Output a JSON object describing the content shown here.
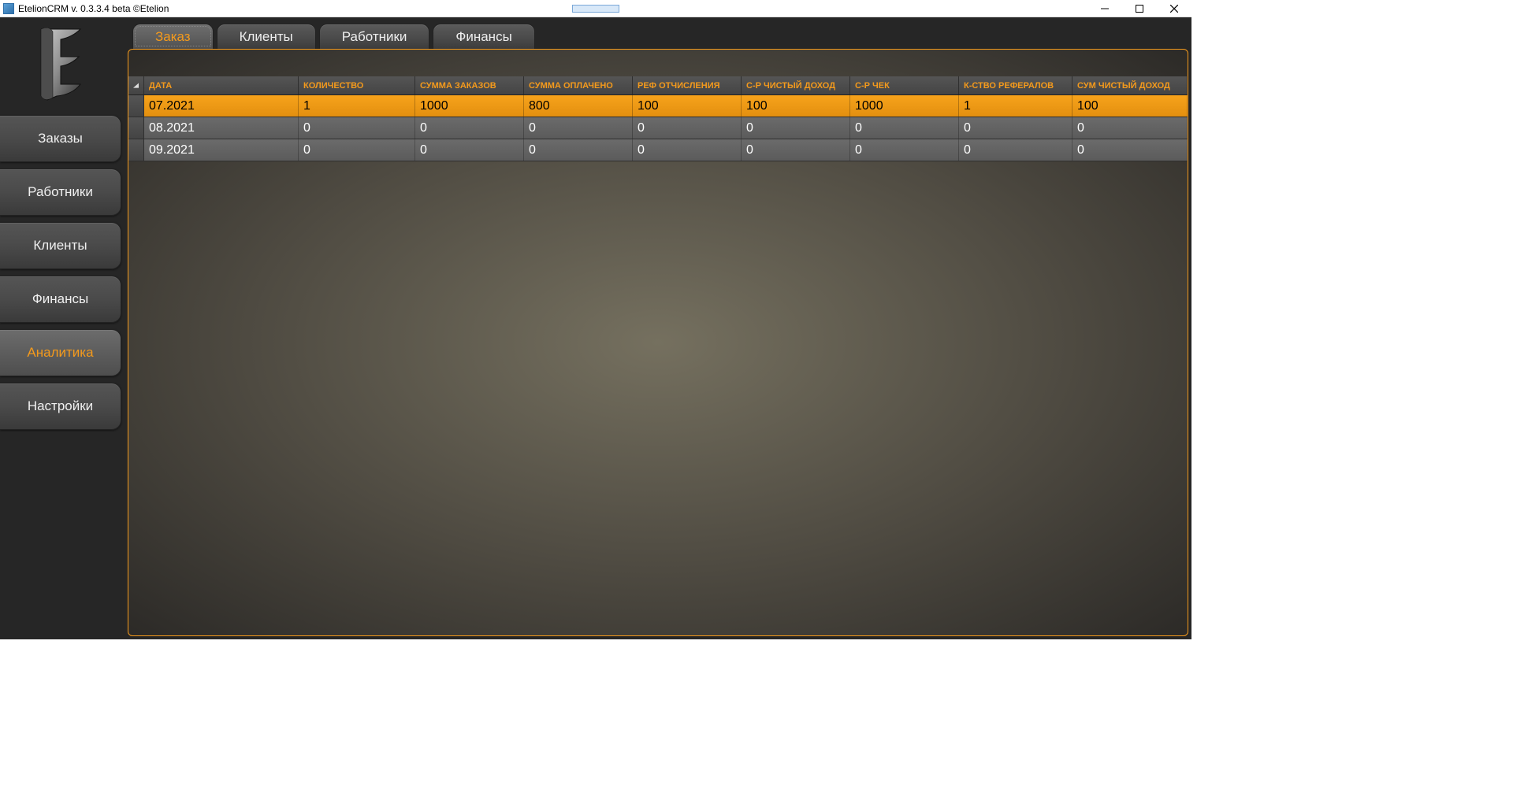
{
  "window": {
    "title": "EtelionCRM v. 0.3.3.4 beta ©Etelion"
  },
  "sidebar": {
    "items": [
      {
        "label": "Заказы",
        "active": false
      },
      {
        "label": "Работники",
        "active": false
      },
      {
        "label": "Клиенты",
        "active": false
      },
      {
        "label": "Финансы",
        "active": false
      },
      {
        "label": "Аналитика",
        "active": true
      },
      {
        "label": "Настройки",
        "active": false
      }
    ]
  },
  "tabs": [
    {
      "label": "Заказ",
      "active": true
    },
    {
      "label": "Клиенты",
      "active": false
    },
    {
      "label": "Работники",
      "active": false
    },
    {
      "label": "Финансы",
      "active": false
    }
  ],
  "grid": {
    "columns": [
      "ДАТА",
      "КОЛИЧЕСТВО",
      "СУММА ЗАКАЗОВ",
      "СУММА ОПЛАЧЕНО",
      "РЕФ ОТЧИСЛЕНИЯ",
      "С-Р ЧИСТЫЙ ДОХОД",
      "С-Р ЧЕК",
      "К-СТВО РЕФЕРАЛОВ",
      "СУМ ЧИСТЫЙ ДОХОД"
    ],
    "rows": [
      {
        "selected": true,
        "cells": [
          "07.2021",
          "1",
          "1000",
          "800",
          "100",
          "100",
          "1000",
          "1",
          "100"
        ]
      },
      {
        "selected": false,
        "cells": [
          "08.2021",
          "0",
          "0",
          "0",
          "0",
          "0",
          "0",
          "0",
          "0"
        ]
      },
      {
        "selected": false,
        "cells": [
          "09.2021",
          "0",
          "0",
          "0",
          "0",
          "0",
          "0",
          "0",
          "0"
        ]
      }
    ]
  }
}
